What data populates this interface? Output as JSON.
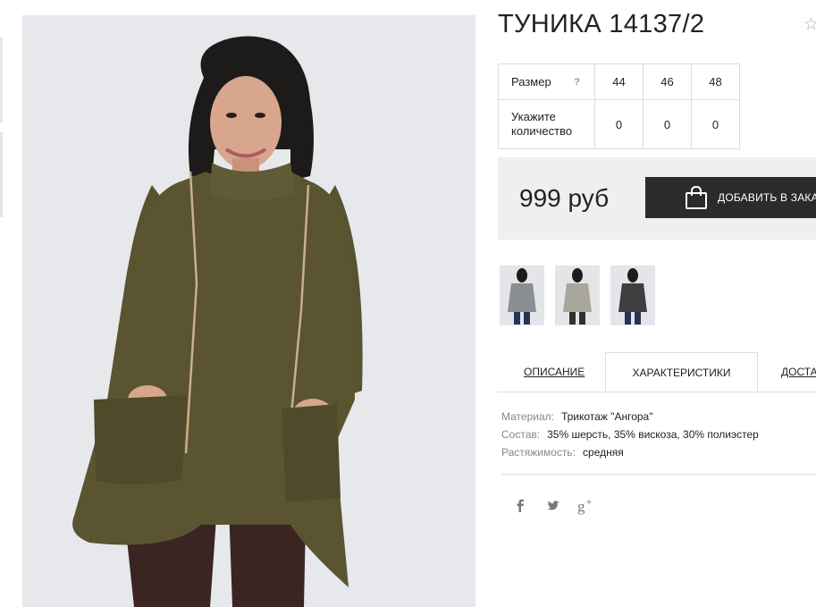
{
  "product": {
    "title": "ТУНИКА 14137/2",
    "price": "999 руб",
    "add_to_cart_label": "ДОБАВИТЬ В ЗАКАЗ"
  },
  "size_table": {
    "size_label": "Размер",
    "help_mark": "?",
    "sizes": [
      "44",
      "46",
      "48"
    ],
    "qty_label": "Укажите количество",
    "quantities": [
      "0",
      "0",
      "0"
    ]
  },
  "tabs": [
    "ОПИСАНИЕ",
    "ХАРАКТЕРИСТИКИ",
    "ДОСТАВКА"
  ],
  "specs": [
    {
      "key": "Материал:",
      "value": "Трикотаж \"Ангора\""
    },
    {
      "key": "Состав:",
      "value": "35% шерсть, 35% вискоза, 30% полиэстер"
    },
    {
      "key": "Растяжимость:",
      "value": "средняя"
    }
  ],
  "social": [
    "facebook-icon",
    "twitter-icon",
    "google-plus-icon"
  ],
  "icons": [
    "favorite-star-icon",
    "shopping-bag-icon"
  ],
  "colors": {
    "button_bg": "#2b2b2b",
    "price_box_bg": "#efefef",
    "border": "#dcdcdc",
    "garment_olive": "#5a5430",
    "thumb_variants": [
      "#8b8e91",
      "#a9a69c",
      "#3e3e40"
    ]
  }
}
